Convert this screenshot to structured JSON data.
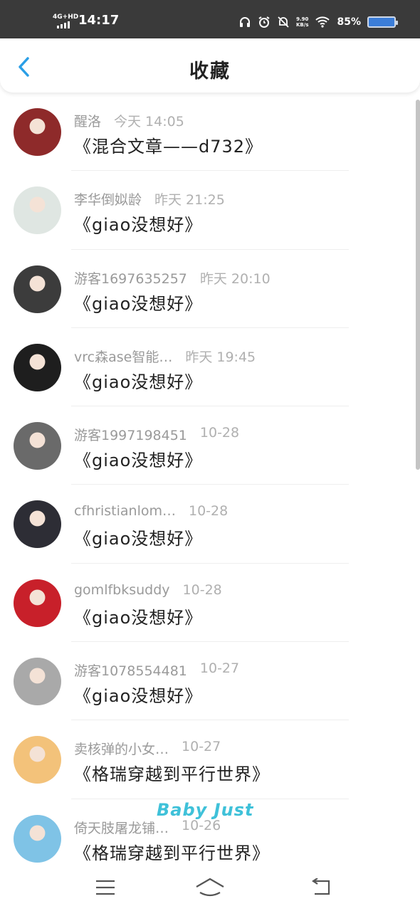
{
  "status_bar": {
    "network": "4G+HD",
    "time": "14:17",
    "speed_value": "9.90",
    "speed_unit": "KB/s",
    "battery": "85%"
  },
  "header": {
    "title": "收藏",
    "back_icon": "chevron-left-icon"
  },
  "favorites": [
    {
      "name": "醒洛",
      "time": "今天 14:05",
      "title": "《混合文章——d732》",
      "avatar_color": "#8e2a2a"
    },
    {
      "name": "李华倒姒龄",
      "time": "昨天 21:25",
      "title": "《giao没想好》",
      "avatar_color": "#dfe6e2"
    },
    {
      "name": "游客1697635257",
      "time": "昨天 20:10",
      "title": "《giao没想好》",
      "avatar_color": "#3c3c3c"
    },
    {
      "name": "vrc森ase智能…",
      "time": "昨天 19:45",
      "title": "《giao没想好》",
      "avatar_color": "#1e1e1e"
    },
    {
      "name": "游客1997198451",
      "time": "10-28",
      "title": "《giao没想好》",
      "avatar_color": "#6a6a6a"
    },
    {
      "name": "cfhristianlom…",
      "time": "10-28",
      "title": "《giao没想好》",
      "avatar_color": "#2d2d35"
    },
    {
      "name": "gomlfbksuddy",
      "time": "10-28",
      "title": "《giao没想好》",
      "avatar_color": "#c8202a"
    },
    {
      "name": "游客1078554481",
      "time": "10-27",
      "title": "《giao没想好》",
      "avatar_color": "#a9a9a9"
    },
    {
      "name": "卖核弹的小女…",
      "time": "10-27",
      "title": "《格瑞穿越到平行世界》",
      "avatar_color": "#f3c27a"
    },
    {
      "name": "倚天肢屠龙铺…",
      "time": "10-26",
      "title": "《格瑞穿越到平行世界》",
      "avatar_color": "#7fc3e6"
    }
  ],
  "watermark": "Baby Just",
  "nav": {
    "menu_icon": "menu-icon",
    "home_icon": "home-icon",
    "back_icon": "back-arrow-icon"
  },
  "colors": {
    "accent": "#2b9fe6",
    "status_bar": "#3a3a3a",
    "watermark": "#3fc1d9"
  }
}
